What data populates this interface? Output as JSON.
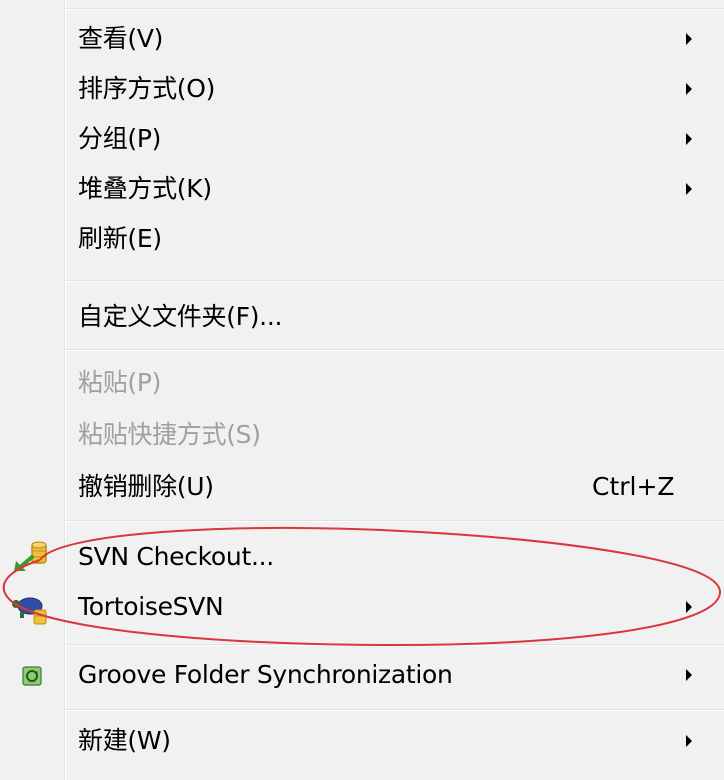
{
  "menu": {
    "items": [
      {
        "label": "查看(V)",
        "submenu": true,
        "disabled": false
      },
      {
        "label": "排序方式(O)",
        "submenu": true,
        "disabled": false
      },
      {
        "label": "分组(P)",
        "submenu": true,
        "disabled": false
      },
      {
        "label": "堆叠方式(K)",
        "submenu": true,
        "disabled": false
      },
      {
        "label": "刷新(E)",
        "submenu": false,
        "disabled": false
      },
      {
        "label": "自定义文件夹(F)...",
        "submenu": false,
        "disabled": false
      },
      {
        "label": "粘贴(P)",
        "submenu": false,
        "disabled": true
      },
      {
        "label": "粘贴快捷方式(S)",
        "submenu": false,
        "disabled": true
      },
      {
        "label": "撤销删除(U)",
        "submenu": false,
        "disabled": false,
        "shortcut": "Ctrl+Z"
      },
      {
        "label": "SVN Checkout...",
        "submenu": false,
        "disabled": false,
        "icon": "svn-checkout-icon"
      },
      {
        "label": "TortoiseSVN",
        "submenu": true,
        "disabled": false,
        "icon": "tortoisesvn-icon"
      },
      {
        "label": "Groove Folder Synchronization",
        "submenu": true,
        "disabled": false,
        "icon": "groove-sync-icon"
      },
      {
        "label": "新建(W)",
        "submenu": true,
        "disabled": false
      }
    ]
  },
  "colors": {
    "menu_bg": "#f1f1f1",
    "disabled_text": "#a0a0a0",
    "highlight_oval": "#d9363e"
  }
}
